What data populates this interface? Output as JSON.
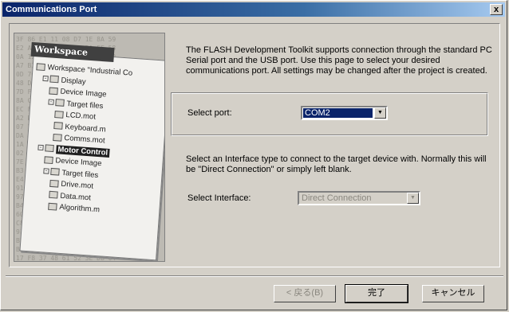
{
  "window": {
    "title": "Communications Port",
    "close_label": "x"
  },
  "illustration": {
    "header": "Workspace",
    "tree": [
      {
        "label": "Workspace \"Industrial Co",
        "indent": 0,
        "pm": ""
      },
      {
        "label": "Display",
        "indent": 1,
        "pm": "-"
      },
      {
        "label": "Device Image",
        "indent": 2,
        "pm": ""
      },
      {
        "label": "Target files",
        "indent": 2,
        "pm": "-"
      },
      {
        "label": "LCD.mot",
        "indent": 3,
        "pm": ""
      },
      {
        "label": "Keyboard.m",
        "indent": 3,
        "pm": ""
      },
      {
        "label": "Comms.mot",
        "indent": 3,
        "pm": ""
      },
      {
        "label": "Motor Control",
        "indent": 1,
        "pm": "-",
        "selected": true
      },
      {
        "label": "Device Image",
        "indent": 2,
        "pm": ""
      },
      {
        "label": "Target files",
        "indent": 2,
        "pm": "-"
      },
      {
        "label": "Drive.mot",
        "indent": 3,
        "pm": ""
      },
      {
        "label": "Data.mot",
        "indent": 3,
        "pm": ""
      },
      {
        "label": "Algorithm.m",
        "indent": 3,
        "pm": ""
      }
    ]
  },
  "description": "The FLASH Development Toolkit supports connection through the standard PC Serial port and the USB port. Use this page to select your desired communications port. All settings may be changed after the project is created.",
  "port": {
    "label": "Select port:",
    "value": "COM2"
  },
  "interface_description": "Select an Interface type to connect to the target device with. Normally this will be \"Direct Connection\" or simply left blank.",
  "interface": {
    "label": "Select Interface:",
    "value": "Direct Connection"
  },
  "buttons": {
    "back": "< 戻る(B)",
    "finish": "完了",
    "cancel": "キャンセル"
  }
}
